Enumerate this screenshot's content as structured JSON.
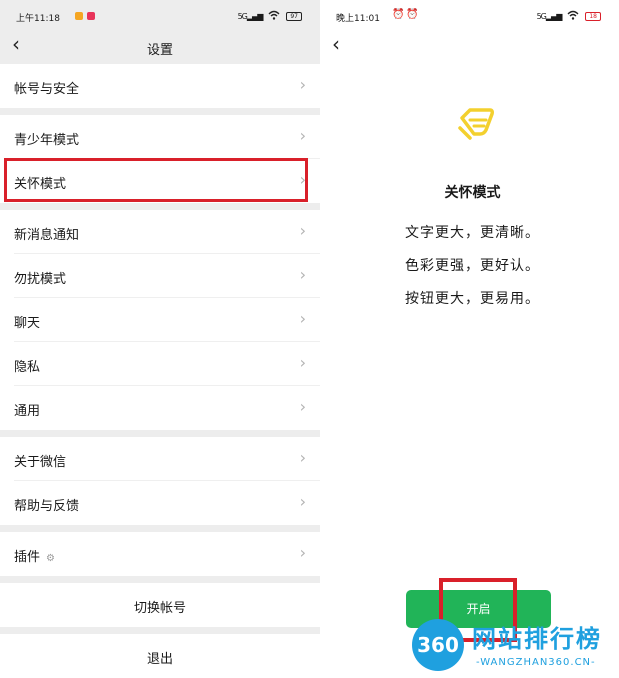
{
  "left": {
    "status": {
      "time": "上午11:18",
      "signal": "5G",
      "battery": "97"
    },
    "title": "设置",
    "items": [
      {
        "label": "帐号与安全"
      },
      {
        "label": "青少年模式"
      },
      {
        "label": "关怀模式"
      },
      {
        "label": "新消息通知"
      },
      {
        "label": "勿扰模式"
      },
      {
        "label": "聊天"
      },
      {
        "label": "隐私"
      },
      {
        "label": "通用"
      },
      {
        "label": "关于微信"
      },
      {
        "label": "帮助与反馈"
      },
      {
        "label": "插件"
      }
    ],
    "switch_account": "切换帐号",
    "logout": "退出"
  },
  "right": {
    "status": {
      "time": "晚上11:01",
      "signal": "5G",
      "battery": "18"
    },
    "title": "关怀模式",
    "lines": [
      "文字更大，更清晰。",
      "色彩更强，更好认。",
      "按钮更大，更易用。"
    ],
    "button": "开启"
  },
  "watermark": {
    "circle": "360",
    "title": "网站排行榜",
    "sub": "-WANGZHAN360.CN-"
  },
  "colors": {
    "accent_green": "#21b458",
    "highlight_red": "#d9202a",
    "watermark_blue": "#1fa0df",
    "icon_yellow": "#f3d02e"
  }
}
